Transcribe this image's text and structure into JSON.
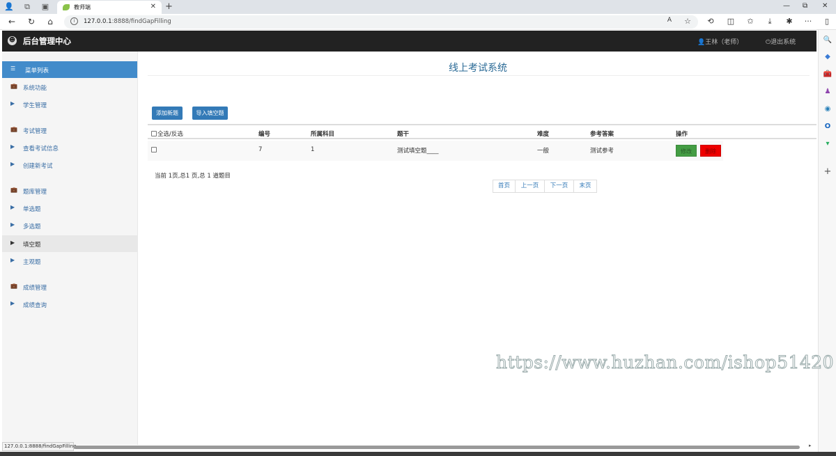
{
  "browser": {
    "tab_title": "教师端",
    "url_prefix": "127.0.0.1",
    "url_rest": ":8888/findGapFilling",
    "status_url": "127.0.0.1:8888/findGapFilling",
    "icons": {
      "profile": "👤",
      "workspaces": "⧉",
      "tab_actions": "▣",
      "close": "✕",
      "new_tab": "+",
      "minimize": "—",
      "restore": "⧉",
      "window_close": "✕",
      "back": "←",
      "refresh": "↻",
      "home": "⌂",
      "read_aloud": "A",
      "favorite": "☆",
      "extension": "⟲",
      "split": "◫",
      "favorites": "✩",
      "download": "⤓",
      "extensions": "✱",
      "more": "···",
      "sidebar_toggle": "▯"
    }
  },
  "edge_sidebar": {
    "icons": [
      "🔍",
      "◆",
      "🧰",
      "♟",
      "◉",
      "O",
      "▾",
      "+"
    ]
  },
  "header": {
    "brand": "后台管理中心",
    "logo_glyph": "☻",
    "user": "王林（老师）",
    "user_icon": "👤",
    "logout": "退出系统",
    "logout_icon": "⏻"
  },
  "sidebar": {
    "menu_title": "菜单列表",
    "items": [
      {
        "label": "系统功能",
        "icon": "💼"
      },
      {
        "label": "学生管理",
        "icon": "▶"
      },
      {
        "label": "考试管理",
        "icon": "💼"
      },
      {
        "label": "查看考试信息",
        "icon": "▶"
      },
      {
        "label": "创建新考试",
        "icon": "▶"
      },
      {
        "label": "题库管理",
        "icon": "💼"
      },
      {
        "label": "单选题",
        "icon": "▶"
      },
      {
        "label": "多选题",
        "icon": "▶"
      },
      {
        "label": "填空题",
        "icon": "▶"
      },
      {
        "label": "主观题",
        "icon": "▶"
      },
      {
        "label": "成绩管理",
        "icon": "💼"
      },
      {
        "label": "成绩查询",
        "icon": "▶"
      }
    ]
  },
  "main": {
    "title": "线上考试系统",
    "add_button": "添加新题",
    "import_button": "导入填空题",
    "table": {
      "headers": [
        "全选/反选",
        "编号",
        "所属科目",
        "题干",
        "难度",
        "参考答案",
        "操作"
      ],
      "rows": [
        {
          "id": "7",
          "subject": "1",
          "stem": "测试填空题____",
          "difficulty": "一般",
          "answer": "测试参考",
          "edit": "修改",
          "delete": "删除"
        }
      ]
    },
    "summary": "当前 1页,总1 页,总 1 道题目",
    "pager": [
      "首页",
      "上一页",
      "下一页",
      "末页"
    ]
  },
  "watermark": "https://www.huzhan.com/ishop51420"
}
